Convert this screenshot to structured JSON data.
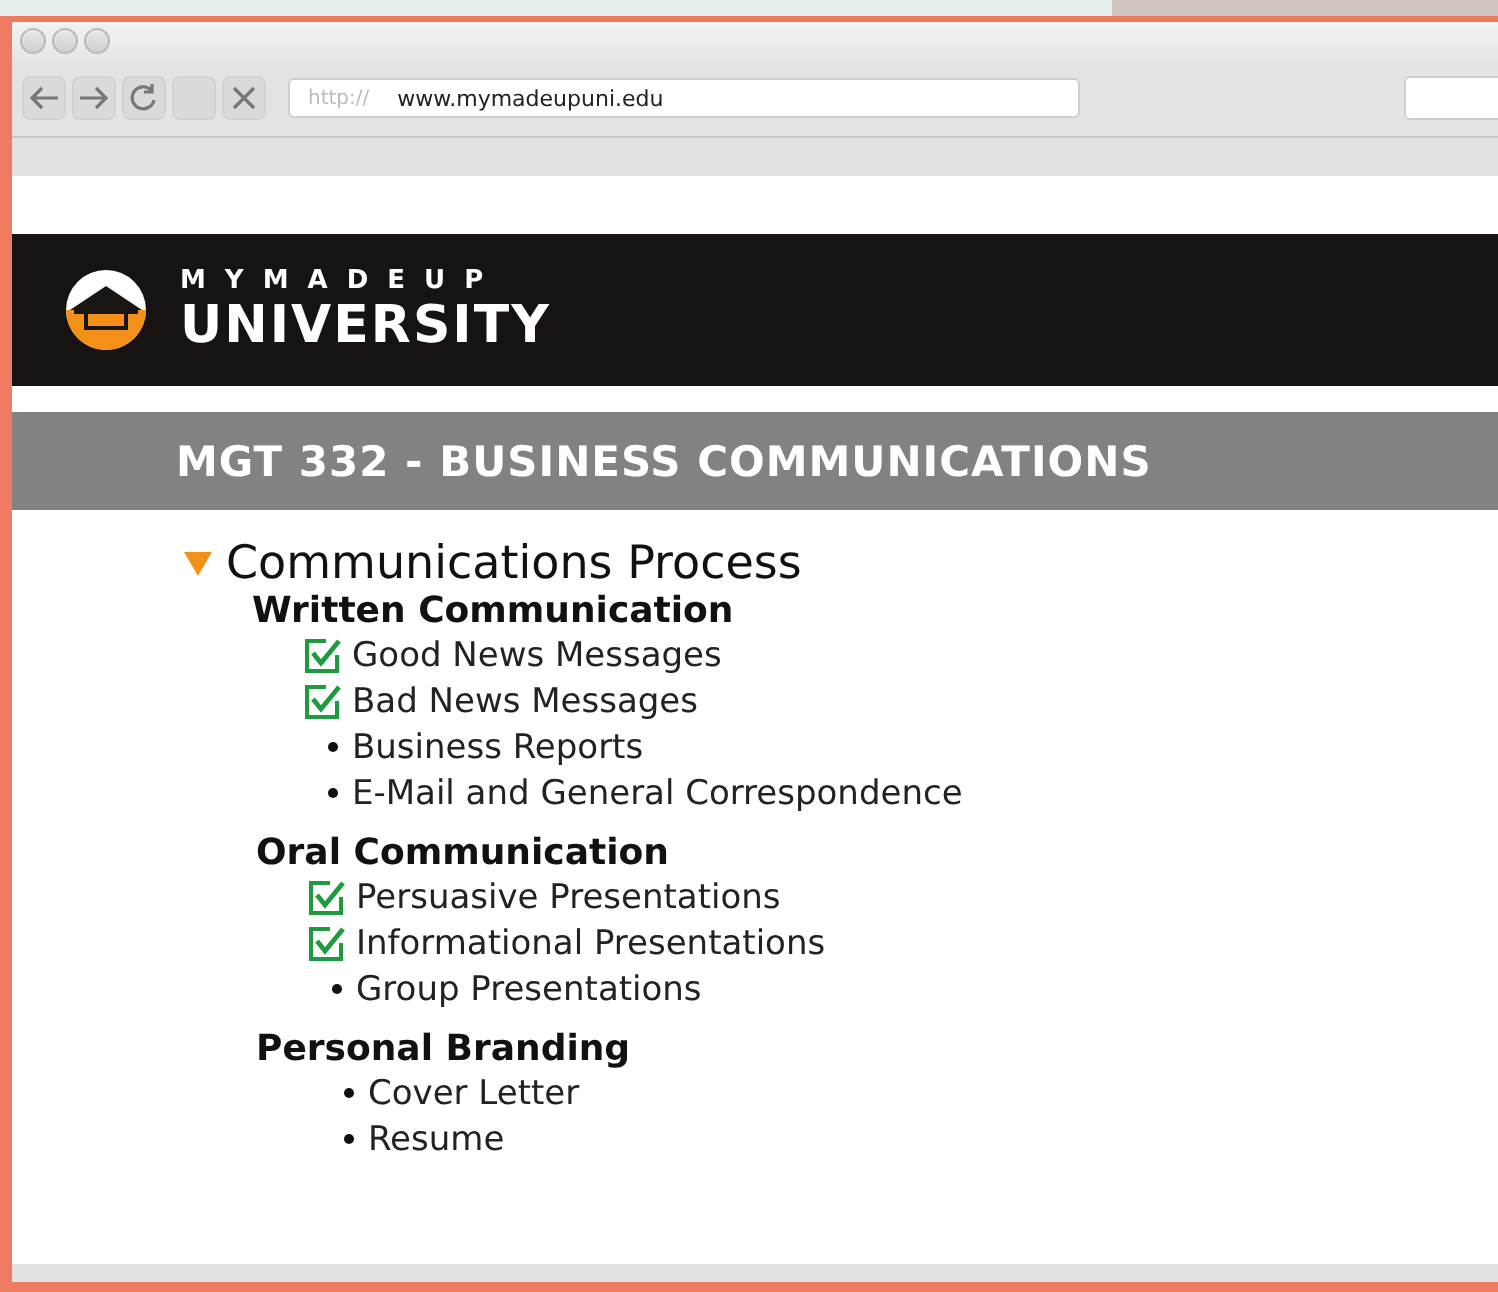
{
  "address_bar": {
    "scheme": "http://",
    "url": "www.mymadeupuni.edu"
  },
  "banner": {
    "logo_top": "MYMADEUP",
    "logo_bottom": "UNIVERSITY"
  },
  "course_title": "MGT 332 - BUSINESS COMMUNICATIONS",
  "outline": {
    "title": "Communications Process",
    "expanded": true,
    "children": [
      {
        "title": "Written Communication",
        "children": [
          {
            "label": "Good News Messages",
            "checked": true
          },
          {
            "label": "Bad News Messages",
            "checked": true
          },
          {
            "label": "Business Reports",
            "checked": false
          },
          {
            "label": "E-Mail and General Correspondence",
            "checked": false
          }
        ]
      },
      {
        "title": "Oral Communication",
        "children": [
          {
            "label": "Persuasive Presentations",
            "checked": true
          },
          {
            "label": "Informational Presentations",
            "checked": true
          },
          {
            "label": "Group Presentations",
            "checked": false
          }
        ]
      },
      {
        "title": "Personal Branding",
        "children": [
          {
            "label": "Cover Letter",
            "checked": false
          },
          {
            "label": "Resume",
            "checked": false
          }
        ]
      }
    ]
  }
}
